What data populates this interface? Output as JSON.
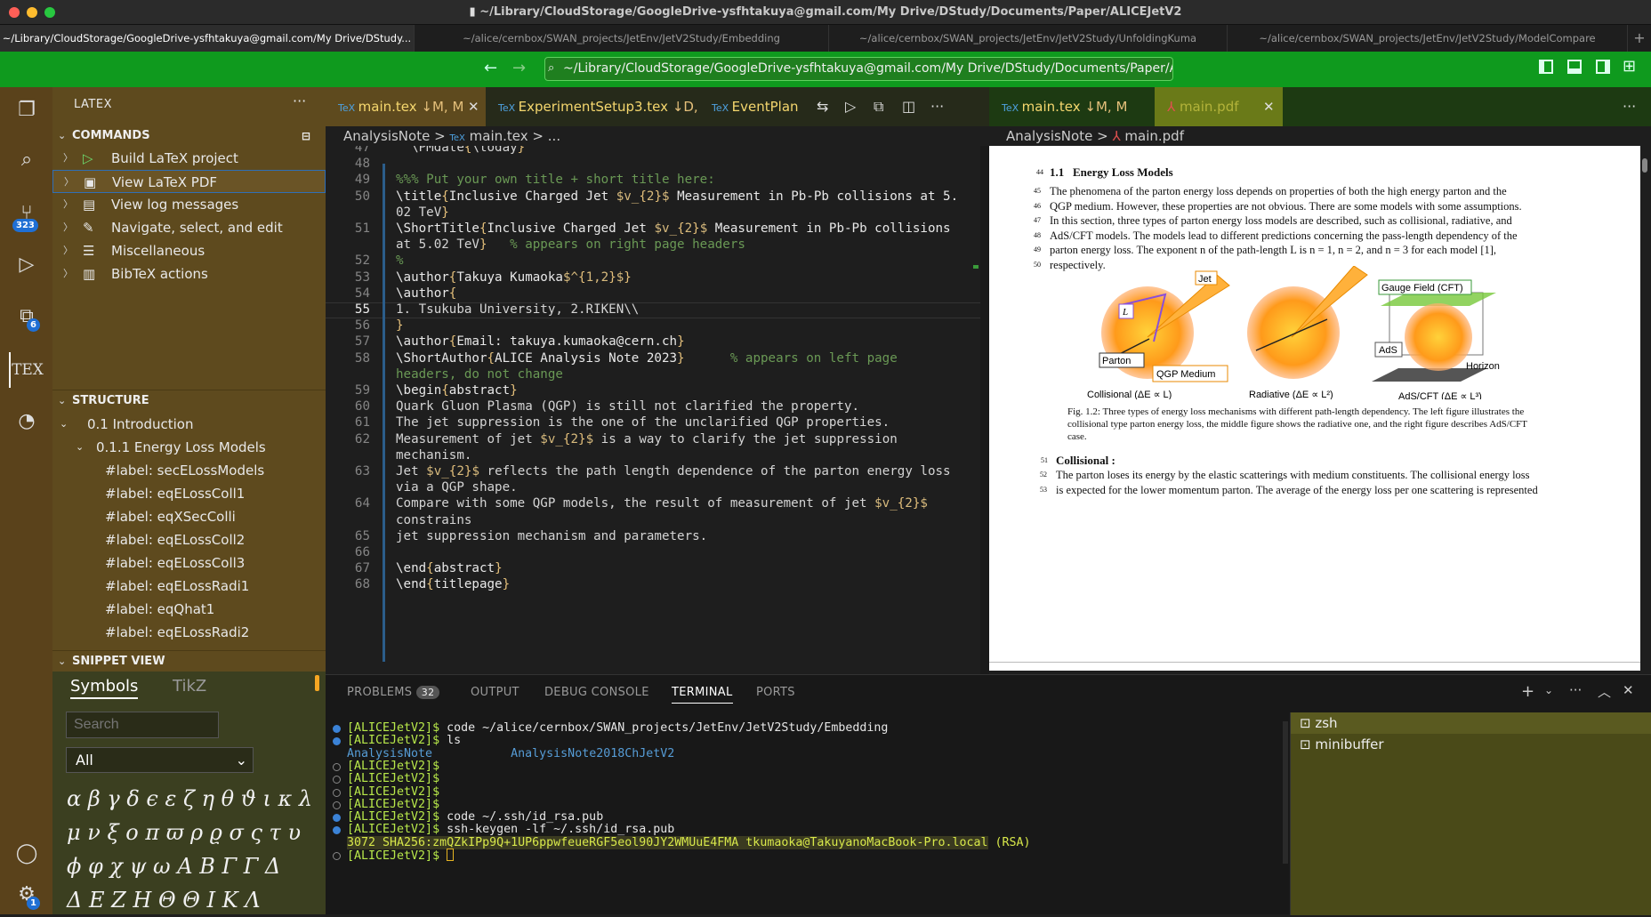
{
  "window": {
    "title": "~/Library/CloudStorage/GoogleDrive-ysfhtakuya@gmail.com/My Drive/DStudy/Documents/Paper/ALICEJetV2"
  },
  "window_tabs": [
    "~/Library/CloudStorage/GoogleDrive-ysfhtakuya@gmail.com/My Drive/DStudy...",
    "~/alice/cernbox/SWAN_projects/JetEnv/JetV2Study/Embedding",
    "~/alice/cernbox/SWAN_projects/JetEnv/JetV2Study/UnfoldingKuma",
    "~/alice/cernbox/SWAN_projects/JetEnv/JetV2Study/ModelCompare"
  ],
  "command_center": "~/Library/CloudStorage/GoogleDrive-ysfhtakuya@gmail.com/My Drive/DStudy/Documents/Paper/ALI...",
  "activity": {
    "scm_badge": "323",
    "ext_badge": "6",
    "settings_badge": "1",
    "tex_label": "TEX"
  },
  "sidebar": {
    "title": "LATEX",
    "commands_header": "COMMANDS",
    "commands": [
      "Build LaTeX project",
      "View LaTeX PDF",
      "View log messages",
      "Navigate, select, and edit",
      "Miscellaneous",
      "BibTeX actions"
    ],
    "structure_header": "STRUCTURE",
    "structure": [
      "0.1 Introduction",
      "0.1.1 Energy Loss Models",
      "#label: secELossModels",
      "#label: eqELossColl1",
      "#label: eqXSecColli",
      "#label: eqELossColl2",
      "#label: eqELossColl3",
      "#label: eqELossRadi1",
      "#label: eqQhat1",
      "#label: eqELossRadi2"
    ],
    "snippet_header": "SNIPPET VIEW",
    "snippet_tabs": [
      "Symbols",
      "TikZ"
    ],
    "search_placeholder": "Search",
    "select_value": "All",
    "symbols": [
      "α β γ δ ϵ ε ζ η θ ϑ ι κ λ",
      "μ ν ξ o π ϖ ρ ϱ σ ς τ υ",
      "ϕ φ χ ψ ω A B Γ Γ Δ",
      "Δ E Z H Θ Θ I K Λ"
    ]
  },
  "editor": {
    "tabs": [
      {
        "label": "main.tex",
        "status": "↓M, M"
      },
      {
        "label": "ExperimentSetup3.tex",
        "status": "↓D, M"
      },
      {
        "label": "EventPlan",
        "status": ""
      }
    ],
    "breadcrumb": [
      "AnalysisNote",
      ">",
      "main.tex",
      ">",
      "..."
    ],
    "lines": [
      {
        "n": "47",
        "t": "  \\PMdate{\\today}"
      },
      {
        "n": "48",
        "t": ""
      },
      {
        "n": "49",
        "t": "%%% Put your own title + short title here:"
      },
      {
        "n": "50",
        "t": "\\title{Inclusive Charged Jet $v_{2}$ Measurement in Pb-Pb collisions at 5."
      },
      {
        "n": "",
        "t": "02 TeV}"
      },
      {
        "n": "51",
        "t": "\\ShortTitle{Inclusive Charged Jet $v_{2}$ Measurement in Pb-Pb collisions"
      },
      {
        "n": "",
        "t": "at 5.02 TeV}   % appears on right page headers"
      },
      {
        "n": "52",
        "t": "%"
      },
      {
        "n": "53",
        "t": "\\author{Takuya Kumaoka$^{1,2}$}"
      },
      {
        "n": "54",
        "t": "\\author{"
      },
      {
        "n": "55",
        "t": "1. Tsukuba University, 2.RIKEN\\\\"
      },
      {
        "n": "56",
        "t": "}"
      },
      {
        "n": "57",
        "t": "\\author{Email: takuya.kumaoka@cern.ch}"
      },
      {
        "n": "58",
        "t": "\\ShortAuthor{ALICE Analysis Note 2023}      % appears on left page"
      },
      {
        "n": "",
        "t": "headers, do not change"
      },
      {
        "n": "59",
        "t": "\\begin{abstract}"
      },
      {
        "n": "60",
        "t": "Quark Gluon Plasma (QGP) is still not clarified the property."
      },
      {
        "n": "61",
        "t": "The jet suppression is the one of the unclarified QGP properties."
      },
      {
        "n": "62",
        "t": "Measurement of jet $v_{2}$ is a way to clarify the jet suppression"
      },
      {
        "n": "",
        "t": "mechanism."
      },
      {
        "n": "63",
        "t": "Jet $v_{2}$ reflects the path length dependence of the parton energy loss"
      },
      {
        "n": "",
        "t": "via a QGP shape."
      },
      {
        "n": "64",
        "t": "Compare with some QGP models, the result of measurement of jet $v_{2}$"
      },
      {
        "n": "",
        "t": "constrains"
      },
      {
        "n": "65",
        "t": "jet suppression mechanism and parameters."
      },
      {
        "n": "66",
        "t": ""
      },
      {
        "n": "67",
        "t": "\\end{abstract}"
      },
      {
        "n": "68",
        "t": "\\end{titlepage}"
      }
    ]
  },
  "pdf": {
    "tabs": [
      {
        "label": "main.tex",
        "status": "↓M, M"
      },
      {
        "label": "main.pdf",
        "status": ""
      }
    ],
    "breadcrumb": [
      "AnalysisNote",
      ">",
      "main.pdf"
    ],
    "section_num": "1.1",
    "section_title": "Energy Loss Models",
    "para": [
      {
        "n": "45",
        "t": "The phenomena of the parton energy loss depends on properties of both the high energy parton and the"
      },
      {
        "n": "46",
        "t": "QGP medium. However, these properties are not obvious. There are some models with some assumptions."
      },
      {
        "n": "47",
        "t": "In this section, three types of parton energy loss models are described, such as collisional, radiative, and"
      },
      {
        "n": "48",
        "t": "AdS/CFT models. The models lead to different predictions concerning the pass-length dependency of the"
      },
      {
        "n": "49",
        "t": "parton energy loss. The exponent n of the path-length L is n = 1, n = 2, and n = 3 for each model [1],"
      },
      {
        "n": "50",
        "t": "respectively."
      }
    ],
    "fig_labels": {
      "jet": "Jet",
      "L": "L",
      "parton": "Parton",
      "qgp": "QGP Medium",
      "gauge": "Gauge Field (CFT)",
      "ads": "AdS",
      "horizon": "Horizon",
      "c1": "Collisional (ΔE ∝ L)",
      "c2": "Radiative (ΔE ∝ L²)",
      "c3": "AdS/CFT (ΔE ∝ L³)"
    },
    "caption": [
      "Fig. 1.2:  Three types of energy loss mechanisms with different path-length dependency. The left figure illustrates the",
      "collisional type parton energy loss, the middle figure shows the radiative one, and the right figure describes AdS/CFT",
      "case."
    ],
    "sub_num": "51",
    "sub_title": "Collisional :",
    "para2": [
      {
        "n": "52",
        "t": "The parton loses its energy by the elastic scatterings with medium constituents. The collisional energy loss"
      },
      {
        "n": "53",
        "t": "is expected for the lower momentum parton. The average of the energy loss per one scattering is represented"
      }
    ]
  },
  "panel": {
    "tabs": [
      "PROBLEMS",
      "OUTPUT",
      "DEBUG CONSOLE",
      "TERMINAL",
      "PORTS"
    ],
    "problems_count": "32",
    "terminal": [
      {
        "prompt": "[ALICEJetV2]$ ",
        "cmd": "code ~/alice/cernbox/SWAN_projects/JetEnv/JetV2Study/Embedding",
        "dot": "#3b82d6"
      },
      {
        "prompt": "[ALICEJetV2]$ ",
        "cmd": "ls",
        "dot": "#3b82d6"
      },
      {
        "prompt": "",
        "cmd": "",
        "ls1": "AnalysisNote",
        "ls2": "AnalysisNote2018ChJetV2",
        "dot": ""
      },
      {
        "prompt": "[ALICEJetV2]$",
        "cmd": "",
        "dot": "hollow"
      },
      {
        "prompt": "[ALICEJetV2]$",
        "cmd": "",
        "dot": "hollow"
      },
      {
        "prompt": "[ALICEJetV2]$",
        "cmd": "",
        "dot": "hollow"
      },
      {
        "prompt": "[ALICEJetV2]$",
        "cmd": "",
        "dot": "hollow"
      },
      {
        "prompt": "[ALICEJetV2]$ ",
        "cmd": "code ~/.ssh/id_rsa.pub",
        "dot": "#3b82d6"
      },
      {
        "prompt": "[ALICEJetV2]$ ",
        "cmd": "ssh-keygen -lf ~/.ssh/id_rsa.pub",
        "dot": "#3b82d6"
      },
      {
        "prompt": "",
        "cmd": "",
        "key": "3072 SHA256:zmQZkIPp9Q+1UP6ppwfeueRGF5eol90JY2WMUuE4FMA tkumaoka@TakuyanoMacBook-Pro.local",
        "rsa": " (RSA)",
        "dot": ""
      },
      {
        "prompt": "[ALICEJetV2]$ ",
        "cmd": "",
        "dot": "hollow"
      }
    ],
    "shells": [
      "zsh",
      "minibuffer"
    ]
  },
  "colors": {
    "accent_green": "#0f9a1e",
    "sidebar_brown": "#5e4a1e",
    "activity_brown": "#5a421b"
  }
}
